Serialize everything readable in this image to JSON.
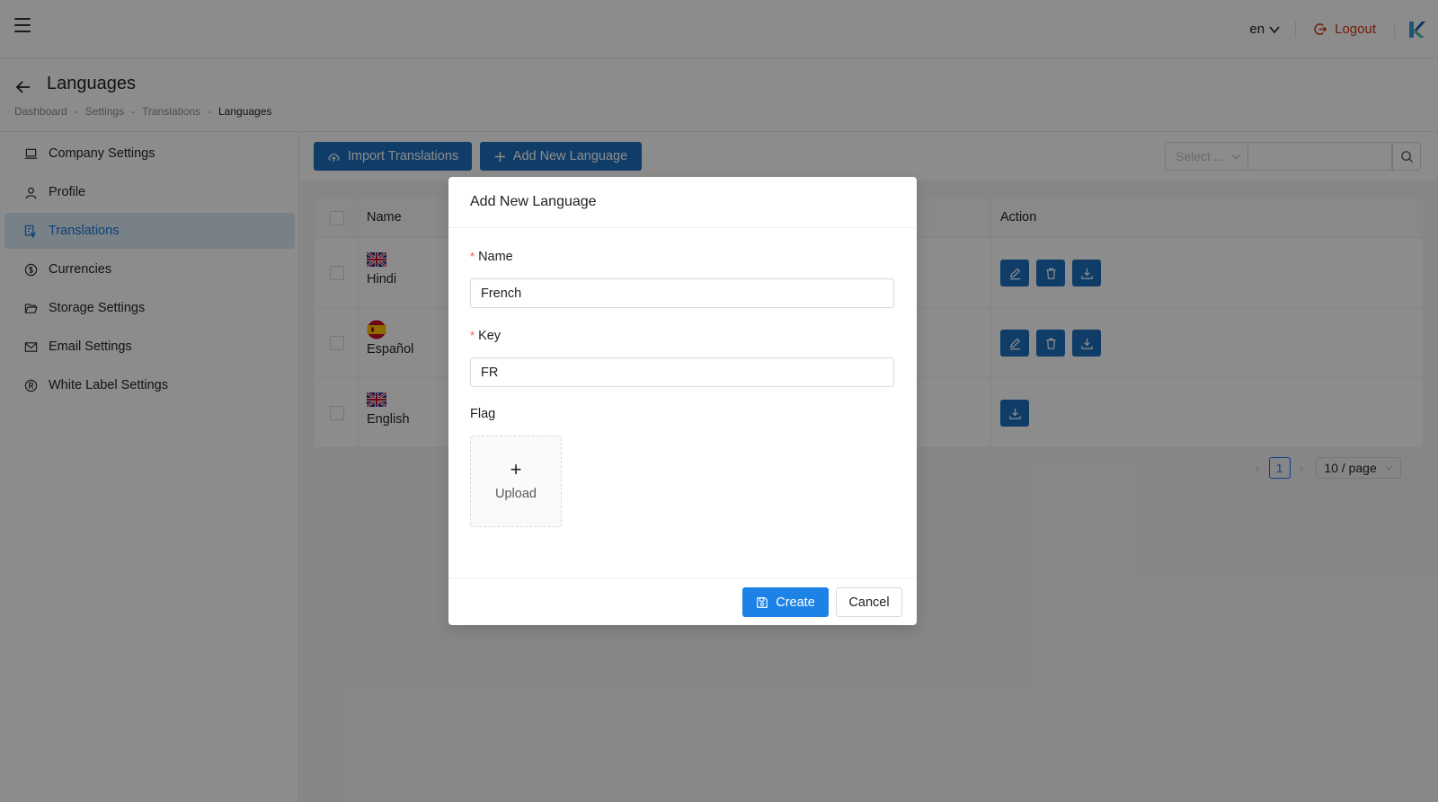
{
  "header": {
    "language": "en",
    "logout_label": "Logout"
  },
  "page": {
    "title": "Languages",
    "breadcrumb": [
      "Dashboard",
      "Settings",
      "Translations",
      "Languages"
    ]
  },
  "sidebar": {
    "items": [
      {
        "label": "Company Settings",
        "icon": "laptop-icon",
        "active": false
      },
      {
        "label": "Profile",
        "icon": "user-icon",
        "active": false
      },
      {
        "label": "Translations",
        "icon": "translation-icon",
        "active": true
      },
      {
        "label": "Currencies",
        "icon": "dollar-circle-icon",
        "active": false
      },
      {
        "label": "Storage Settings",
        "icon": "folder-open-icon",
        "active": false
      },
      {
        "label": "Email Settings",
        "icon": "mail-icon",
        "active": false
      },
      {
        "label": "White Label Settings",
        "icon": "registered-icon",
        "active": false
      }
    ]
  },
  "toolbar": {
    "import_label": "Import Translations",
    "add_label": "Add New Language",
    "select_placeholder": "Select ..."
  },
  "table": {
    "columns": [
      "Name",
      "Action"
    ],
    "rows": [
      {
        "name": "Hindi",
        "flag": "uk-flag-icon",
        "actions": [
          "edit",
          "delete",
          "download"
        ]
      },
      {
        "name": "Español",
        "flag": "spain-flag-icon",
        "actions": [
          "edit",
          "delete",
          "download"
        ]
      },
      {
        "name": "English",
        "flag": "uk-flag-icon",
        "actions": [
          "download"
        ]
      }
    ]
  },
  "pagination": {
    "current_page": "1",
    "page_size": "10 / page"
  },
  "modal": {
    "title": "Add New Language",
    "name_label": "Name",
    "name_value": "French",
    "key_label": "Key",
    "key_value": "FR",
    "flag_label": "Flag",
    "upload_label": "Upload",
    "create_label": "Create",
    "cancel_label": "Cancel"
  },
  "colors": {
    "primary": "#1d6fbe",
    "create_button": "#1d82e6",
    "logout": "#d4380d",
    "active_bg": "#dbeaf8",
    "required": "#ff4d4f"
  }
}
